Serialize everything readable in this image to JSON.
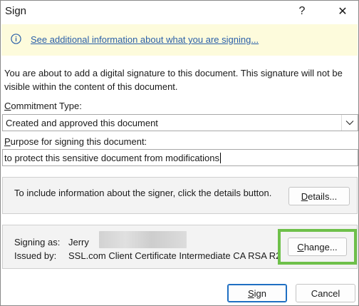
{
  "window": {
    "title": "Sign",
    "help_glyph": "?",
    "close_glyph": "✕"
  },
  "infobar": {
    "icon": "info-icon",
    "link_text": "See additional information about what you are signing..."
  },
  "description": "You are about to add a digital signature to this document. This signature will not be visible within the content of this document.",
  "commitment": {
    "label_access": "C",
    "label_rest": "ommitment Type:",
    "selected": "Created and approved this document",
    "icon": "chevron-down-icon"
  },
  "purpose": {
    "label_access": "P",
    "label_rest": "urpose for signing this document:",
    "value": "to protect this sensitive document from modifications"
  },
  "details_section": {
    "text": "To include information about the signer, click the details button.",
    "button_access": "D",
    "button_rest": "etails..."
  },
  "signer_section": {
    "signing_as_label": "Signing as:",
    "signing_as_name": "Jerry",
    "issued_by_label": "Issued by:",
    "issued_by_value": "SSL.com Client Certificate Intermediate CA RSA R2",
    "change_access": "C",
    "change_rest": "hange...",
    "highlight_color": "#6ec04a"
  },
  "footer": {
    "sign_access": "S",
    "sign_rest": "ign",
    "cancel_label": "Cancel"
  },
  "colors": {
    "infobar_bg": "#fdfbdc",
    "link": "#2a5fa8",
    "primary_border": "#1f6fc2"
  }
}
